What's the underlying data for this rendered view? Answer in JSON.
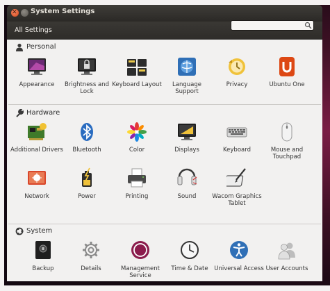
{
  "window": {
    "title": "System Settings"
  },
  "toolbar": {
    "all_settings_label": "All Settings",
    "search_placeholder": ""
  },
  "sections": [
    {
      "label": "Personal",
      "icon": "person-icon",
      "items": [
        {
          "label": "Appearance",
          "icon": "appearance-icon"
        },
        {
          "label": "Brightness and Lock",
          "icon": "brightness-lock-icon"
        },
        {
          "label": "Keyboard Layout",
          "icon": "keyboard-layout-icon"
        },
        {
          "label": "Language Support",
          "icon": "language-support-icon"
        },
        {
          "label": "Privacy",
          "icon": "privacy-icon"
        },
        {
          "label": "Ubuntu One",
          "icon": "ubuntu-one-icon"
        }
      ]
    },
    {
      "label": "Hardware",
      "icon": "wrench-icon",
      "items": [
        {
          "label": "Additional Drivers",
          "icon": "additional-drivers-icon"
        },
        {
          "label": "Bluetooth",
          "icon": "bluetooth-icon"
        },
        {
          "label": "Color",
          "icon": "color-icon"
        },
        {
          "label": "Displays",
          "icon": "displays-icon"
        },
        {
          "label": "Keyboard",
          "icon": "keyboard-icon"
        },
        {
          "label": "Mouse and Touchpad",
          "icon": "mouse-touchpad-icon"
        },
        {
          "label": "Network",
          "icon": "network-icon"
        },
        {
          "label": "Power",
          "icon": "power-icon"
        },
        {
          "label": "Printing",
          "icon": "printing-icon"
        },
        {
          "label": "Sound",
          "icon": "sound-icon"
        },
        {
          "label": "Wacom Graphics Tablet",
          "icon": "wacom-tablet-icon"
        }
      ]
    },
    {
      "label": "System",
      "icon": "ubuntu-logo-icon",
      "items": [
        {
          "label": "Backup",
          "icon": "backup-icon"
        },
        {
          "label": "Details",
          "icon": "details-gear-icon"
        },
        {
          "label": "Management Service",
          "icon": "management-service-icon"
        },
        {
          "label": "Time & Date",
          "icon": "time-date-icon"
        },
        {
          "label": "Universal Access",
          "icon": "universal-access-icon"
        },
        {
          "label": "User Accounts",
          "icon": "user-accounts-icon"
        }
      ]
    }
  ],
  "colors": {
    "titlebar": "#2b2926",
    "content_background": "#f2f1f0",
    "close_button": "#e05a2b",
    "ubuntu_one_orange": "#dd4814",
    "management_ring": "#8b1c4c"
  }
}
